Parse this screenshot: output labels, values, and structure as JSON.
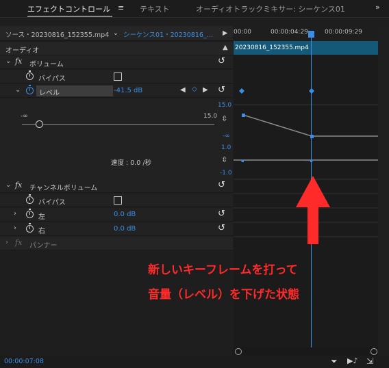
{
  "tabs": [
    {
      "label": "エフェクトコントロール"
    },
    {
      "label": "テキスト"
    },
    {
      "label": "オーディオトラックミキサー: シーケンス01"
    }
  ],
  "source": {
    "label": "ソース・20230816_152355.mp4",
    "sequence": "シーケンス01・20230816_..."
  },
  "timeline": {
    "ruler": [
      "00:00",
      "00:00:04:29",
      "00:00:09:29"
    ],
    "clip_name": "20230816_152355.mp4",
    "current_time": "00:00:07:08"
  },
  "effects": {
    "audio_header": "オーディオ",
    "volume": {
      "label": "ボリューム",
      "bypass_label": "バイパス",
      "level_label": "レベル",
      "level_value": "-41.5 dB",
      "slider_min": "-∞",
      "slider_max": "15.0",
      "slider_value_fraction": 0.09,
      "speed_label": "速度 : 0.0 /秒"
    },
    "channel_volume": {
      "label": "チャンネルボリューム",
      "bypass_label": "バイパス",
      "left_label": "左",
      "left_value": "0.0 dB",
      "right_label": "右",
      "right_value": "0.0 dB"
    },
    "panner": {
      "label": "パンナー"
    }
  },
  "graph": {
    "top_max": "15.0",
    "top_min": "-∞",
    "bottom_max": "1.0",
    "bottom_min": "-1.0"
  },
  "annotation": {
    "line1": "新しいキーフレームを打って",
    "line2": "音量（レベル）を下げた状態"
  },
  "colors": {
    "accent_blue": "#3b8ee8",
    "clip_bar": "#145a78",
    "annotation_red": "#ff2a2a"
  }
}
